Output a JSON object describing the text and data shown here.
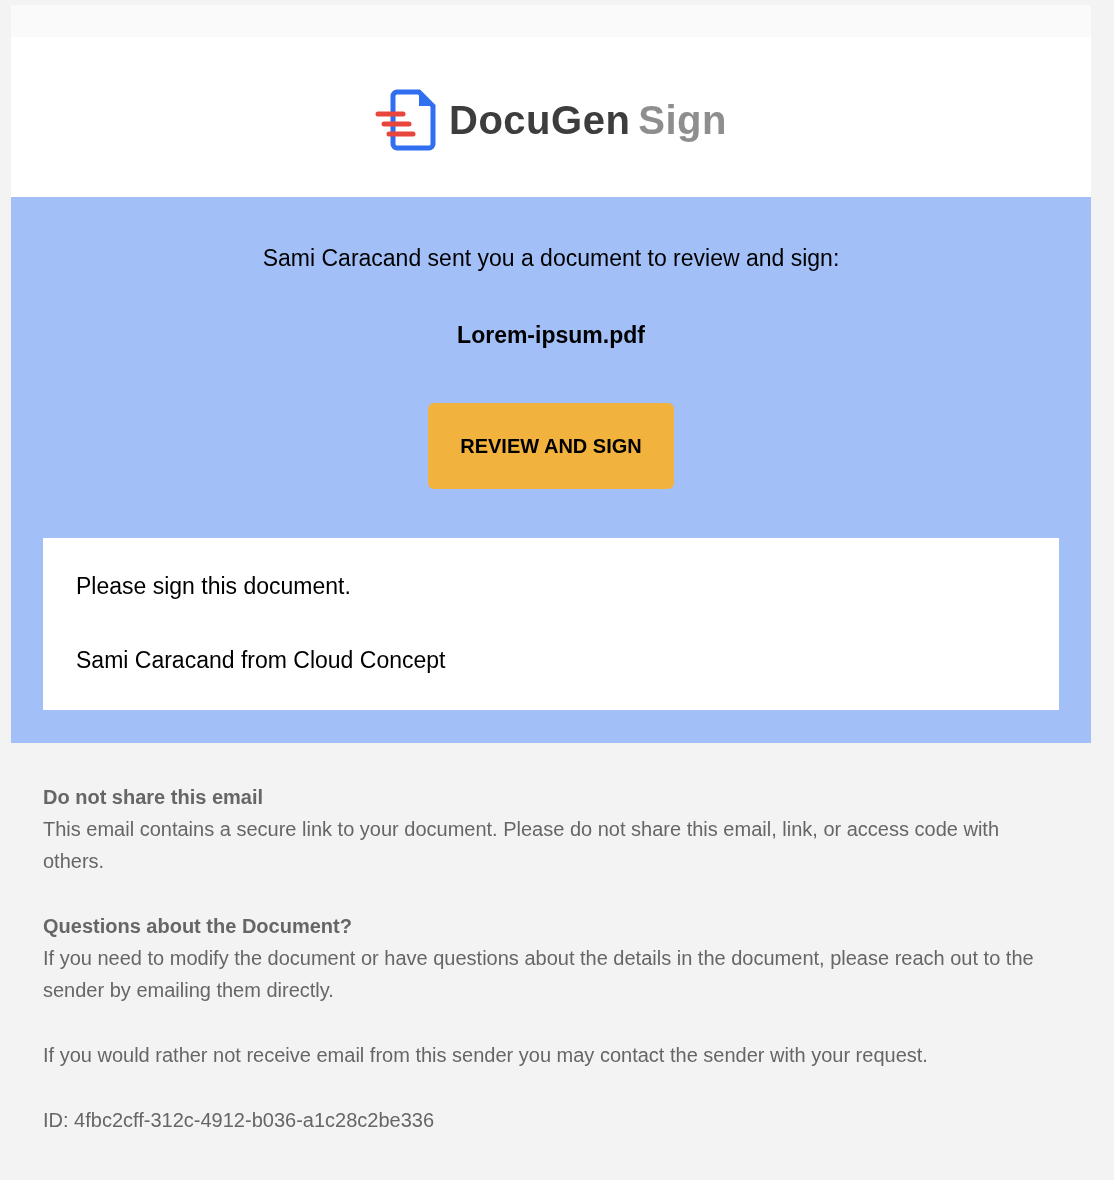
{
  "logo": {
    "brand": "DocuGen",
    "product": "Sign"
  },
  "invite": {
    "message": "Sami Caracand sent you a document to review and sign:",
    "document": "Lorem-ipsum.pdf",
    "button": "REVIEW AND SIGN"
  },
  "note": {
    "lines": [
      "Please sign this document.",
      "Sami Caracand from Cloud Concept"
    ]
  },
  "footer": {
    "sections": [
      {
        "heading": "Do not share this email",
        "text": "This email contains a secure link to your document. Please do not share this email, link, or access code with others."
      },
      {
        "heading": "Questions about the Document?",
        "text": "If you need to modify the document or have questions about the details in the document, please reach out to the sender by emailing them directly."
      },
      {
        "text": "If you would rather not receive email from this sender you may contact the sender with your request."
      },
      {
        "text": "ID: 4fbc2cff-312c-4912-b036-a1c28c2be336"
      }
    ]
  }
}
